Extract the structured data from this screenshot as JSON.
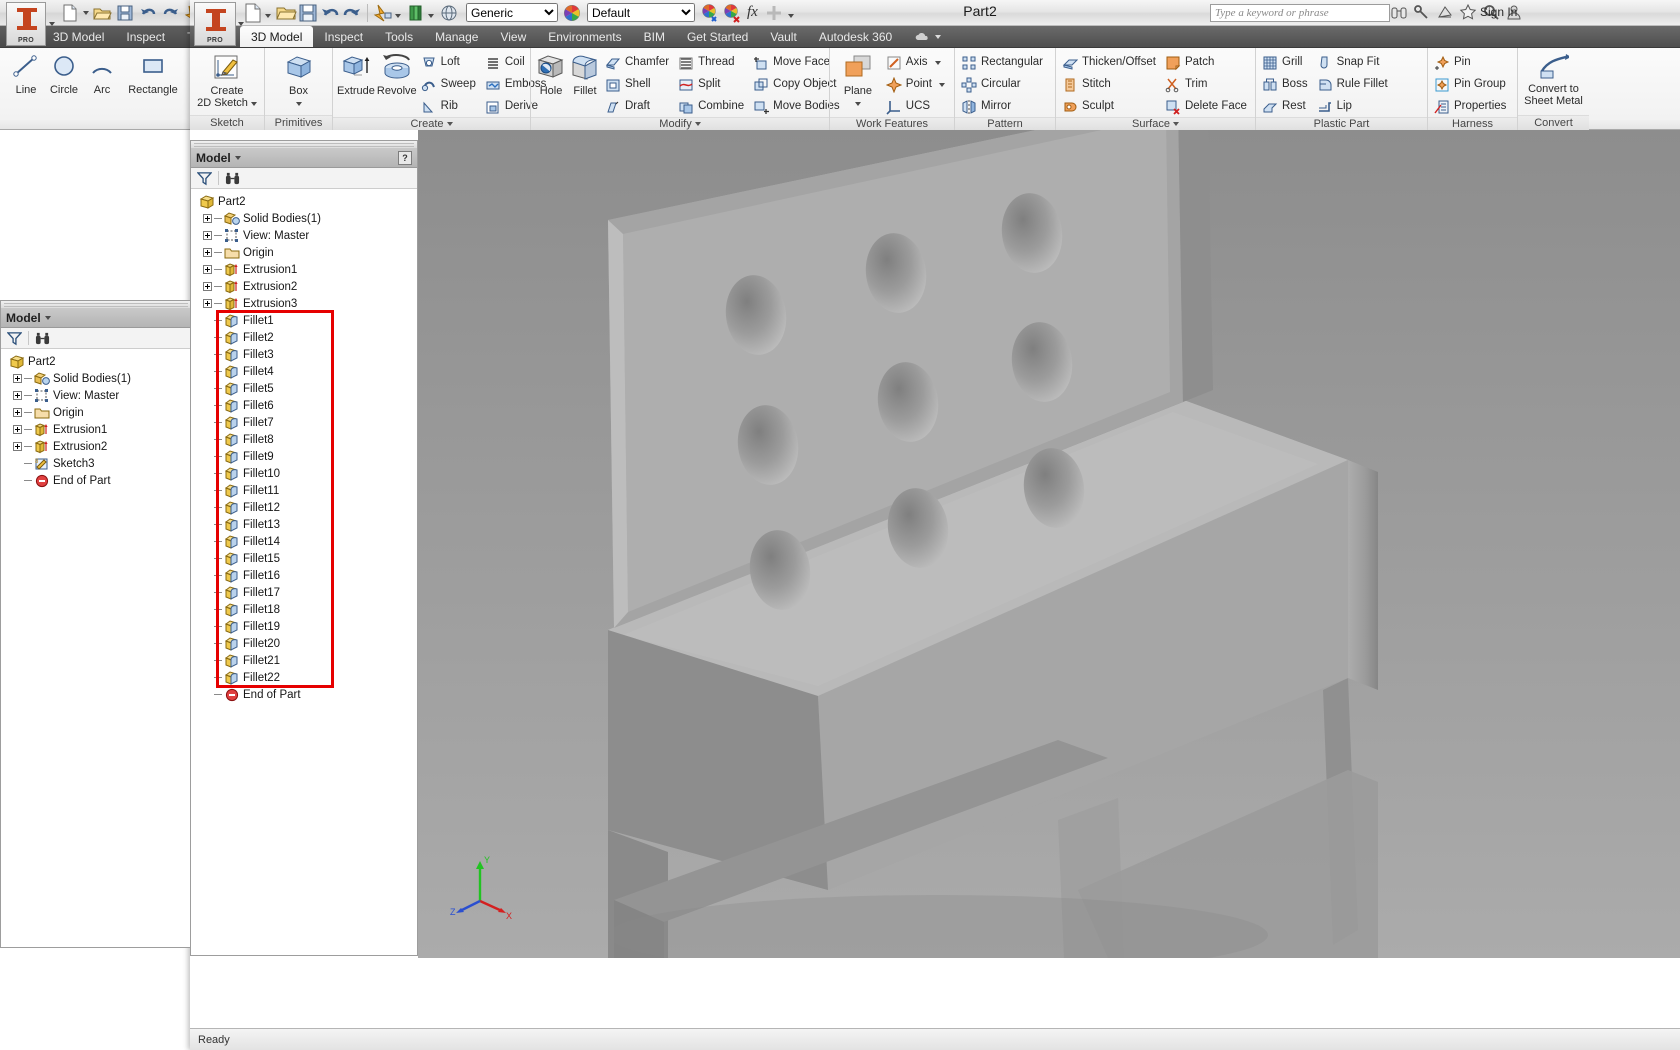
{
  "app": {
    "logo_text": "PRO",
    "title": "Part2",
    "status": "Ready",
    "sign_in": "Sign In"
  },
  "quick_access": {
    "material_value": "Generic",
    "appearance_value": "Default",
    "fx_label": "fx",
    "icons": [
      "new-document-icon",
      "open-folder-icon",
      "save-icon",
      "undo-icon",
      "redo-icon",
      "update-icon",
      "material-library-icon",
      "appearance-globe-icon"
    ]
  },
  "search": {
    "placeholder": "Type a keyword or phrase",
    "icons": [
      "binoculars-icon",
      "key-icon",
      "satellite-dish-icon",
      "star-icon",
      "magnifier-icon",
      "user-icon"
    ]
  },
  "tabs": [
    {
      "label": "3D Model",
      "active": true
    },
    {
      "label": "Inspect",
      "active": false
    },
    {
      "label": "Tools",
      "active": false
    },
    {
      "label": "Manage",
      "active": false
    },
    {
      "label": "View",
      "active": false
    },
    {
      "label": "Environments",
      "active": false
    },
    {
      "label": "BIM",
      "active": false
    },
    {
      "label": "Get Started",
      "active": false
    },
    {
      "label": "Vault",
      "active": false
    },
    {
      "label": "Autodesk 360",
      "active": false
    }
  ],
  "back_window": {
    "tabs": [
      "3D Model",
      "Inspect",
      "Too"
    ],
    "panels": [
      {
        "title": "Sketch",
        "big": [
          "Create",
          "2D Sketch"
        ]
      },
      {
        "title": "Primitives",
        "big": [
          "Box"
        ]
      }
    ],
    "extra_buttons": [
      "Extrude",
      "Re"
    ],
    "ribbon_tabs": [
      "3D Model",
      "Inspect",
      "Too"
    ]
  },
  "ribbon": {
    "panels": [
      {
        "title": "Sketch",
        "show_caret": false,
        "big": [
          {
            "label_top": "Create",
            "label_bottom": "2D Sketch",
            "icon": "create-2d-sketch-icon",
            "has_caret": true
          }
        ],
        "small": []
      },
      {
        "title": "Primitives",
        "show_caret": false,
        "big": [
          {
            "label_top": "Box",
            "label_bottom": "",
            "icon": "box-primitive-icon",
            "has_caret": true
          }
        ],
        "small": []
      },
      {
        "title": "Create",
        "show_caret": true,
        "big": [
          {
            "label_top": "Extrude",
            "label_bottom": "",
            "icon": "extrude-icon",
            "has_caret": false
          },
          {
            "label_top": "Revolve",
            "label_bottom": "",
            "icon": "revolve-icon",
            "has_caret": false
          }
        ],
        "small": [
          [
            {
              "label": "Loft",
              "icon": "loft-icon"
            },
            {
              "label": "Sweep",
              "icon": "sweep-icon"
            },
            {
              "label": "Rib",
              "icon": "rib-icon"
            }
          ],
          [
            {
              "label": "Coil",
              "icon": "coil-icon"
            },
            {
              "label": "Emboss",
              "icon": "emboss-icon"
            },
            {
              "label": "Derive",
              "icon": "derive-icon"
            }
          ]
        ]
      },
      {
        "title": "Modify",
        "show_caret": true,
        "big": [
          {
            "label_top": "Hole",
            "label_bottom": "",
            "icon": "hole-icon",
            "has_caret": false
          },
          {
            "label_top": "Fillet",
            "label_bottom": "",
            "icon": "fillet-icon",
            "has_caret": false
          }
        ],
        "small": [
          [
            {
              "label": "Chamfer",
              "icon": "chamfer-icon"
            },
            {
              "label": "Shell",
              "icon": "shell-icon"
            },
            {
              "label": "Draft",
              "icon": "draft-icon"
            }
          ],
          [
            {
              "label": "Thread",
              "icon": "thread-icon"
            },
            {
              "label": "Split",
              "icon": "split-icon"
            },
            {
              "label": "Combine",
              "icon": "combine-icon"
            }
          ],
          [
            {
              "label": "Move Face",
              "icon": "move-face-icon"
            },
            {
              "label": "Copy Object",
              "icon": "copy-object-icon"
            },
            {
              "label": "Move Bodies",
              "icon": "move-bodies-icon"
            }
          ]
        ]
      },
      {
        "title": "Work Features",
        "show_caret": false,
        "big": [
          {
            "label_top": "Plane",
            "label_bottom": "",
            "icon": "work-plane-icon",
            "has_caret": true
          }
        ],
        "small": [
          [
            {
              "label": "Axis",
              "icon": "work-axis-icon",
              "caret": true
            },
            {
              "label": "Point",
              "icon": "work-point-icon",
              "caret": true
            },
            {
              "label": "UCS",
              "icon": "ucs-icon"
            }
          ]
        ]
      },
      {
        "title": "Pattern",
        "show_caret": false,
        "big": [],
        "small": [
          [
            {
              "label": "Rectangular",
              "icon": "rectangular-pattern-icon"
            },
            {
              "label": "Circular",
              "icon": "circular-pattern-icon"
            },
            {
              "label": "Mirror",
              "icon": "mirror-icon"
            }
          ]
        ]
      },
      {
        "title": "Surface",
        "show_caret": true,
        "big": [],
        "small": [
          [
            {
              "label": "Thicken/Offset",
              "icon": "thicken-offset-icon"
            },
            {
              "label": "Stitch",
              "icon": "stitch-icon"
            },
            {
              "label": "Sculpt",
              "icon": "sculpt-icon"
            }
          ],
          [
            {
              "label": "Patch",
              "icon": "patch-icon"
            },
            {
              "label": "Trim",
              "icon": "trim-icon"
            },
            {
              "label": "Delete Face",
              "icon": "delete-face-icon"
            }
          ]
        ]
      },
      {
        "title": "Plastic Part",
        "show_caret": false,
        "big": [],
        "small": [
          [
            {
              "label": "Grill",
              "icon": "grill-icon"
            },
            {
              "label": "Boss",
              "icon": "boss-icon"
            },
            {
              "label": "Rest",
              "icon": "rest-icon"
            }
          ],
          [
            {
              "label": "Snap Fit",
              "icon": "snap-fit-icon"
            },
            {
              "label": "Rule Fillet",
              "icon": "rule-fillet-icon"
            },
            {
              "label": "Lip",
              "icon": "lip-icon"
            }
          ]
        ]
      },
      {
        "title": "Harness",
        "show_caret": false,
        "big": [],
        "small": [
          [
            {
              "label": "Pin",
              "icon": "pin-icon"
            },
            {
              "label": "Pin Group",
              "icon": "pin-group-icon"
            },
            {
              "label": "Properties",
              "icon": "properties-icon"
            }
          ]
        ]
      },
      {
        "title": "Convert",
        "show_caret": false,
        "big": [
          {
            "label_top": "Convert to",
            "label_bottom": "Sheet Metal",
            "icon": "convert-sheet-metal-icon",
            "has_caret": false
          }
        ],
        "small": []
      }
    ]
  },
  "browser_back": {
    "title": "Model",
    "tree": [
      {
        "label": "Part2",
        "icon": "part-icon",
        "indent": 0,
        "expander": "none"
      },
      {
        "label": "Solid Bodies(1)",
        "icon": "solid-bodies-icon",
        "indent": 1,
        "expander": "plus"
      },
      {
        "label": "View: Master",
        "icon": "view-master-icon",
        "indent": 1,
        "expander": "plus"
      },
      {
        "label": "Origin",
        "icon": "origin-folder-icon",
        "indent": 1,
        "expander": "plus"
      },
      {
        "label": "Extrusion1",
        "icon": "extrusion-icon",
        "indent": 1,
        "expander": "plus"
      },
      {
        "label": "Extrusion2",
        "icon": "extrusion-icon",
        "indent": 1,
        "expander": "plus"
      },
      {
        "label": "Sketch3",
        "icon": "sketch-icon",
        "indent": 1,
        "expander": "none"
      },
      {
        "label": "End of Part",
        "icon": "end-of-part-icon",
        "indent": 1,
        "expander": "none"
      }
    ]
  },
  "browser_front": {
    "title": "Model",
    "toolbar_icons": [
      "filter-icon",
      "find-binoculars-icon"
    ],
    "help_badge": "?",
    "tree": [
      {
        "label": "Part2",
        "icon": "part-icon",
        "indent": 0,
        "expander": "none"
      },
      {
        "label": "Solid Bodies(1)",
        "icon": "solid-bodies-icon",
        "indent": 1,
        "expander": "plus"
      },
      {
        "label": "View: Master",
        "icon": "view-master-icon",
        "indent": 1,
        "expander": "plus"
      },
      {
        "label": "Origin",
        "icon": "origin-folder-icon",
        "indent": 1,
        "expander": "plus"
      },
      {
        "label": "Extrusion1",
        "icon": "extrusion-icon",
        "indent": 1,
        "expander": "plus"
      },
      {
        "label": "Extrusion2",
        "icon": "extrusion-icon",
        "indent": 1,
        "expander": "plus"
      },
      {
        "label": "Extrusion3",
        "icon": "extrusion-icon",
        "indent": 1,
        "expander": "plus"
      },
      {
        "label": "Fillet1",
        "icon": "fillet-feature-icon",
        "indent": 1,
        "expander": "dash"
      },
      {
        "label": "Fillet2",
        "icon": "fillet-feature-icon",
        "indent": 1,
        "expander": "dash"
      },
      {
        "label": "Fillet3",
        "icon": "fillet-feature-icon",
        "indent": 1,
        "expander": "dash"
      },
      {
        "label": "Fillet4",
        "icon": "fillet-feature-icon",
        "indent": 1,
        "expander": "dash"
      },
      {
        "label": "Fillet5",
        "icon": "fillet-feature-icon",
        "indent": 1,
        "expander": "dash"
      },
      {
        "label": "Fillet6",
        "icon": "fillet-feature-icon",
        "indent": 1,
        "expander": "dash"
      },
      {
        "label": "Fillet7",
        "icon": "fillet-feature-icon",
        "indent": 1,
        "expander": "dash"
      },
      {
        "label": "Fillet8",
        "icon": "fillet-feature-icon",
        "indent": 1,
        "expander": "dash"
      },
      {
        "label": "Fillet9",
        "icon": "fillet-feature-icon",
        "indent": 1,
        "expander": "dash"
      },
      {
        "label": "Fillet10",
        "icon": "fillet-feature-icon",
        "indent": 1,
        "expander": "dash"
      },
      {
        "label": "Fillet11",
        "icon": "fillet-feature-icon",
        "indent": 1,
        "expander": "dash"
      },
      {
        "label": "Fillet12",
        "icon": "fillet-feature-icon",
        "indent": 1,
        "expander": "dash"
      },
      {
        "label": "Fillet13",
        "icon": "fillet-feature-icon",
        "indent": 1,
        "expander": "dash"
      },
      {
        "label": "Fillet14",
        "icon": "fillet-feature-icon",
        "indent": 1,
        "expander": "dash"
      },
      {
        "label": "Fillet15",
        "icon": "fillet-feature-icon",
        "indent": 1,
        "expander": "dash"
      },
      {
        "label": "Fillet16",
        "icon": "fillet-feature-icon",
        "indent": 1,
        "expander": "dash"
      },
      {
        "label": "Fillet17",
        "icon": "fillet-feature-icon",
        "indent": 1,
        "expander": "dash"
      },
      {
        "label": "Fillet18",
        "icon": "fillet-feature-icon",
        "indent": 1,
        "expander": "dash"
      },
      {
        "label": "Fillet19",
        "icon": "fillet-feature-icon",
        "indent": 1,
        "expander": "dash"
      },
      {
        "label": "Fillet20",
        "icon": "fillet-feature-icon",
        "indent": 1,
        "expander": "dash"
      },
      {
        "label": "Fillet21",
        "icon": "fillet-feature-icon",
        "indent": 1,
        "expander": "dash"
      },
      {
        "label": "Fillet22",
        "icon": "fillet-feature-icon",
        "indent": 1,
        "expander": "dash"
      },
      {
        "label": "End of Part",
        "icon": "end-of-part-icon",
        "indent": 1,
        "expander": "none"
      }
    ],
    "highlight": {
      "color": "#e60000",
      "from_label": "Fillet1",
      "to_label": "Fillet22"
    }
  },
  "viewport": {
    "model_name": "chair-3d-model",
    "background_top": "#8f8f8f",
    "background_bottom": "#a8a8a8",
    "axis": {
      "x": "X",
      "y": "Y",
      "z": "Z",
      "x_color": "#d42020",
      "y_color": "#22c322",
      "z_color": "#2a4fd0"
    }
  }
}
